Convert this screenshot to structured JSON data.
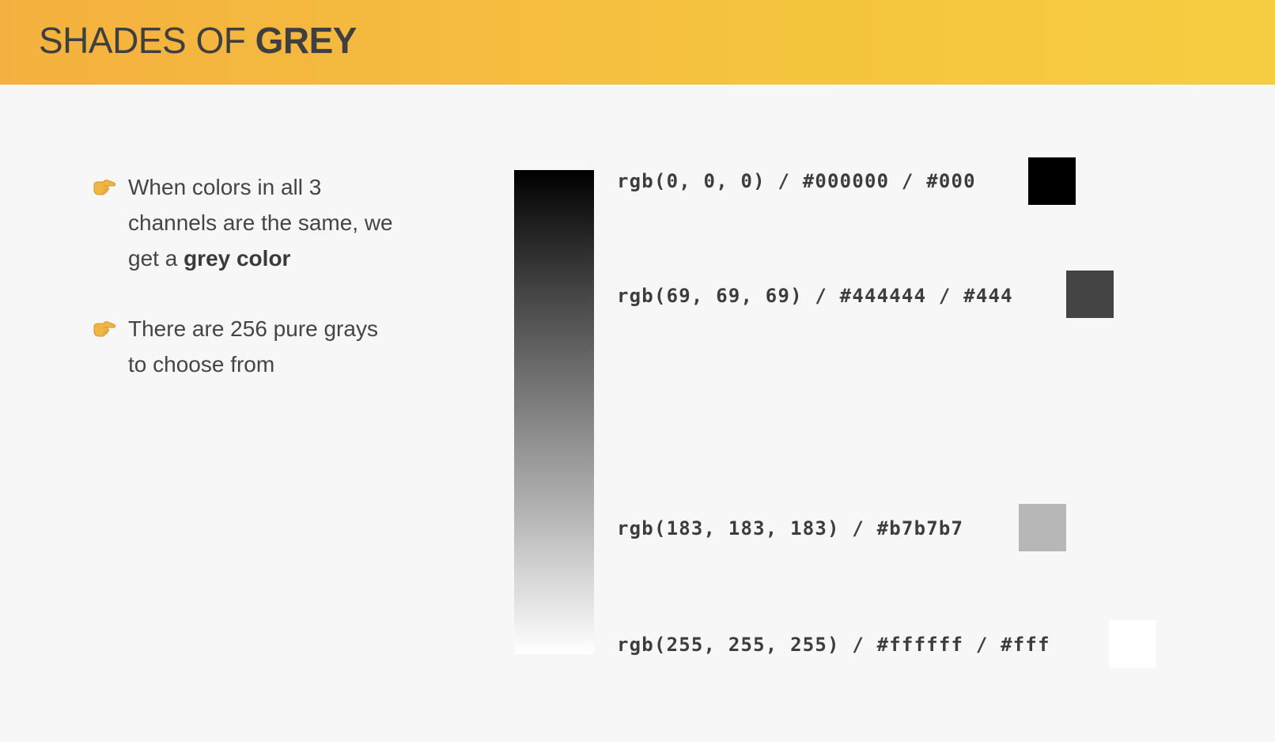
{
  "header": {
    "title_light": "SHADES OF ",
    "title_bold": "GREY",
    "background": "#f5bb40"
  },
  "bullets": [
    {
      "icon": "pointing-hand-icon",
      "text_plain": "When colors in all 3 channels are the same, we get a ",
      "text_bold": "grey color"
    },
    {
      "icon": "pointing-hand-icon",
      "text_plain": "There are 256 pure grays to choose from",
      "text_bold": ""
    }
  ],
  "gradient": {
    "from": "#000000",
    "to": "#ffffff"
  },
  "swatches": [
    {
      "label": "rgb(0, 0, 0) / #000000 / #000",
      "color": "#000000"
    },
    {
      "label": "rgb(69, 69, 69) / #444444 / #444",
      "color": "#444444"
    },
    {
      "label": "rgb(183, 183, 183) / #b7b7b7",
      "color": "#b7b7b7"
    },
    {
      "label": "rgb(255, 255, 255) / #ffffff / #fff",
      "color": "#ffffff"
    }
  ]
}
